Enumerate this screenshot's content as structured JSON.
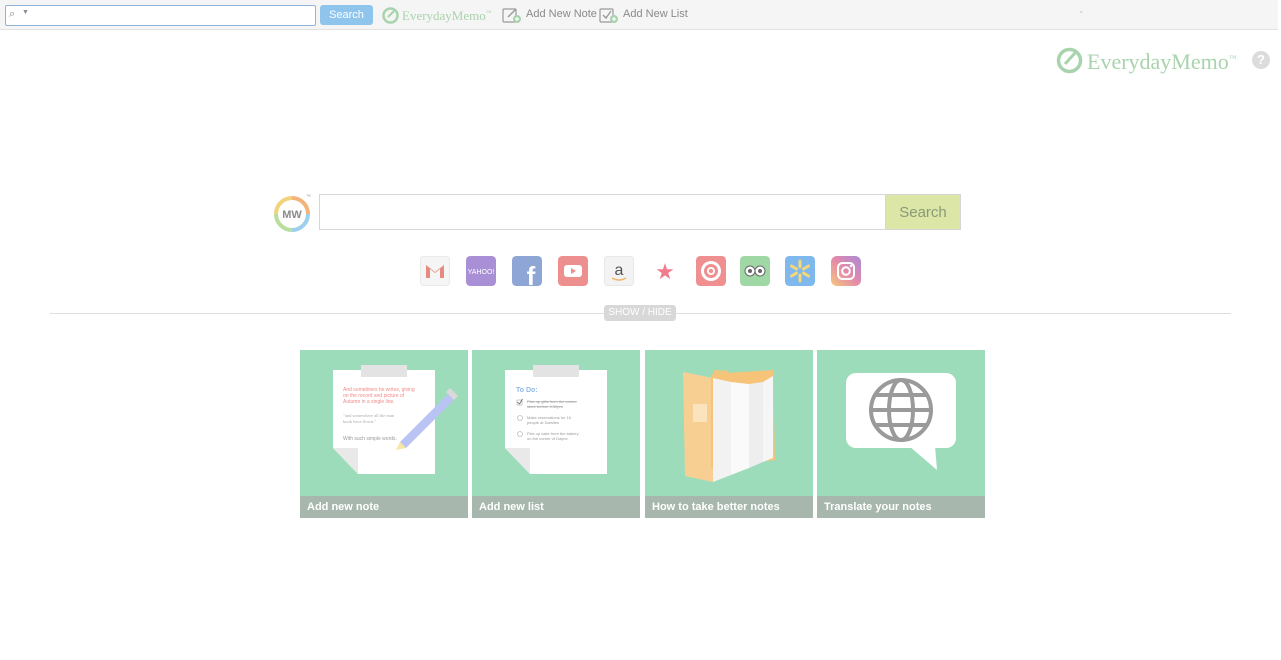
{
  "toolbar": {
    "search_placeholder": "",
    "search_button": "Search",
    "logo_text": "EverydayMemo",
    "logo_tm": "™",
    "add_note": "Add New Note",
    "add_list": "Add New List",
    "end_glyph": "ﾞ"
  },
  "header": {
    "logo_text": "EverydayMemo",
    "logo_tm": "™",
    "help": "?"
  },
  "search": {
    "logo_text": "MW",
    "logo_tm": "™",
    "placeholder": "",
    "button": "Search"
  },
  "quick_links": [
    {
      "name": "gmail",
      "text": "M",
      "color": "#e58b81"
    },
    {
      "name": "yahoo",
      "text": "YAHOO!",
      "color": "#a98fd6"
    },
    {
      "name": "facebook",
      "text": "f",
      "color": "#8ea6d5"
    },
    {
      "name": "youtube",
      "text": "",
      "color": "#ee8f8f"
    },
    {
      "name": "amazon",
      "text": "a",
      "color": "#f3f3f3"
    },
    {
      "name": "macys",
      "text": "★",
      "color": "#f17d8c"
    },
    {
      "name": "target",
      "text": "",
      "color": "#f08f90"
    },
    {
      "name": "tripadvisor",
      "text": "",
      "color": "#9fd8a5"
    },
    {
      "name": "walmart",
      "text": "",
      "color": "#7fb8ec"
    },
    {
      "name": "instagram",
      "text": "",
      "color": "#d68bc4"
    }
  ],
  "show_hide": "SHOW / HIDE",
  "tiles": [
    {
      "caption": "Add new note",
      "note_line1": "And sometimes he writes, giving",
      "note_line2": "on the record and picture of",
      "note_line3": "Autumn in a single line.",
      "note_line4": "\"and somewhere all the man",
      "note_line5": "book have flown.\"",
      "note_line6": "With such simple words."
    },
    {
      "caption": "Add new list",
      "todo_title": "To Do:",
      "todo_1": "Pick up gifts from the corner",
      "todo_1b": "store before 4:30pm",
      "todo_2": "Make reservations for 16",
      "todo_2b": "people at Damiles",
      "todo_3": "Pick up cake from the bakery",
      "todo_3b": "on the corner of Dayne"
    },
    {
      "caption": "How to take better notes"
    },
    {
      "caption": "Translate your notes"
    }
  ],
  "colors": {
    "toolbar_button": "#8fc5ec",
    "main_button": "#dbe6a7",
    "tile": "#9ddcbb",
    "tile_caption": "#a7b7ad",
    "logo_green": "#a9d3ad"
  }
}
